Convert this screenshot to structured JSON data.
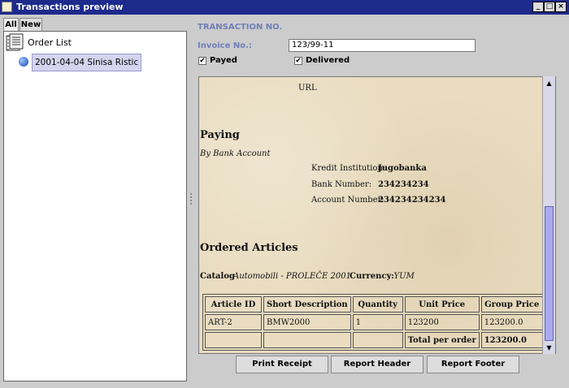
{
  "window": {
    "title": "Transactions preview"
  },
  "tabs": [
    {
      "label": "All"
    },
    {
      "label": "New"
    }
  ],
  "tree": {
    "root_label": "Order List",
    "node_label": "2001-04-04 Sinisa Ristic"
  },
  "form": {
    "section_title": "TRANSACTION NO.",
    "invoice_label": "Invoice No.:",
    "invoice_value": "123/99-11",
    "payed_label": "Payed",
    "payed_checked": true,
    "delivered_label": "Delivered",
    "delivered_checked": true
  },
  "report": {
    "url_label": "URL",
    "paying_heading": "Paying",
    "paying_method": "By Bank Account",
    "kredit_label": "Kredit Institution:",
    "kredit_value": "Jugobanka",
    "bank_label": "Bank Number:",
    "bank_value": "234234234",
    "account_label": "Account Number:",
    "account_value": "234234234234",
    "articles_heading": "Ordered Articles",
    "catalog_label": "Catalog",
    "catalog_value": "Automobili - PROLEČE 2001",
    "currency_label": "Currency:",
    "currency_value": ": YUM",
    "table": {
      "headers": [
        "Article ID",
        "Short Description",
        "Quantity",
        "Unit Price",
        "Group Price"
      ],
      "rows": [
        [
          "ART-2",
          "BMW2000",
          "1",
          "123200",
          "123200.0"
        ]
      ],
      "total_label": "Total per order",
      "total_value": "123200.0"
    }
  },
  "buttons": {
    "print_receipt": "Print Receipt",
    "report_header": "Report Header",
    "report_footer": "Report Footer"
  }
}
